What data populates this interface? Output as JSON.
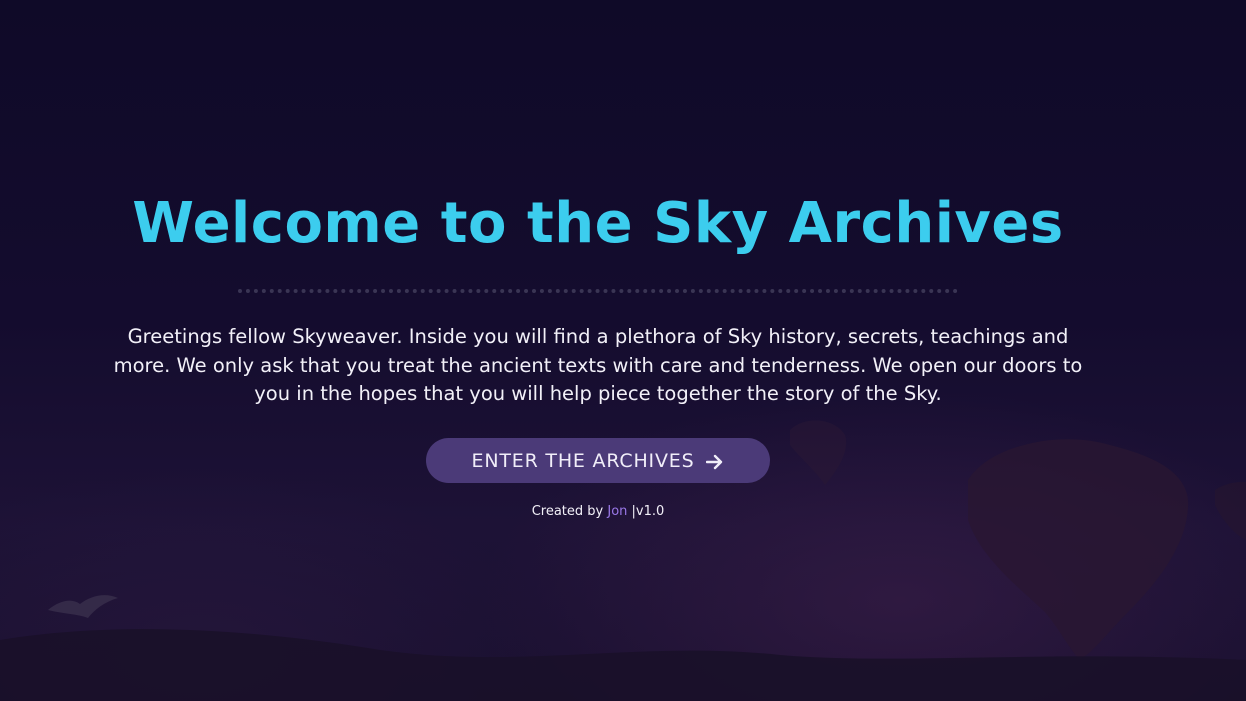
{
  "hero": {
    "title": "Welcome to the Sky Archives",
    "intro": "Greetings fellow Skyweaver. Inside you will find a plethora of Sky history, secrets, teachings and more. We only ask that you treat the ancient texts with care and tenderness. We open our doors to you in the hopes that you will help piece together the story of the Sky.",
    "enter_label": "ENTER THE ARCHIVES",
    "enter_icon": "arrow-right-icon"
  },
  "footer": {
    "created_prefix": "Created by",
    "author": "Jon",
    "separator": "|",
    "version": "v1.0"
  },
  "colors": {
    "background": "#120c2a",
    "title": "#3ccdee",
    "button": "#4b3a78",
    "author_link": "#9a78e8"
  }
}
